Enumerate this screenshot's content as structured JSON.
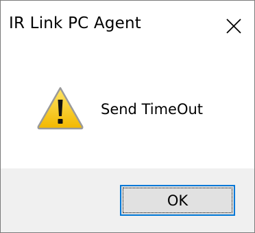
{
  "window": {
    "title": "IR Link PC Agent"
  },
  "message": {
    "text": "Send TimeOut",
    "icon": "warning-icon"
  },
  "buttons": {
    "ok_label": "OK",
    "close_icon": "close-icon"
  },
  "colors": {
    "accent": "#0078d7",
    "footer_background": "#f0f0f0",
    "button_face": "#e1e1e1",
    "warning_yellow": "#f5c400"
  }
}
